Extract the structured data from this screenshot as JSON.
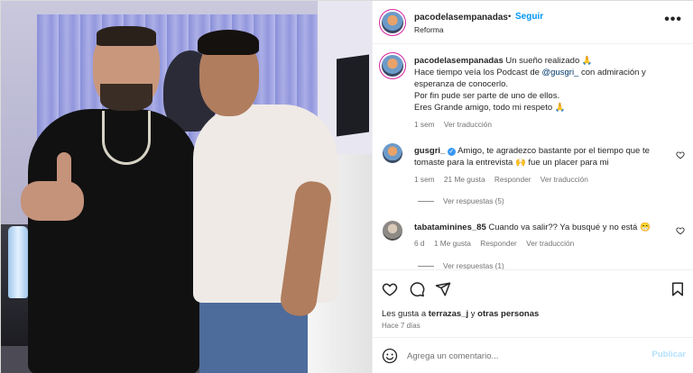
{
  "post": {
    "username": "pacodelasempanadas",
    "follow_label": "Seguir",
    "location": "Reforma",
    "more_label": "•••",
    "photo_alt": "Two men posing in a studio"
  },
  "caption": {
    "username": "pacodelasempanadas",
    "line1": "Un sueño realizado 🙏",
    "line2_pre": "Hace tiempo veía los Podcast de ",
    "mention": "@gusgri_",
    "line2_post": " con admiración y",
    "line3": "esperanza de conocerlo.",
    "line4": "Por fin pude ser parte de uno de ellos.",
    "line5": "Eres Grande amigo, todo mi respeto 🙏",
    "time": "1 sem",
    "translate": "Ver traducción"
  },
  "comments": [
    {
      "username": "gusgri_",
      "verified_mark": "✓",
      "text": "Amigo, te agradezco bastante por el tiempo que te tomaste para la entrevista 🙌 fue un placer para mi",
      "time": "1 sem",
      "likes": "21 Me gusta",
      "reply": "Responder",
      "translate": "Ver traducción",
      "replies": "Ver respuestas (5)"
    },
    {
      "username": "tabataminines_85",
      "text": "Cuando va salir?? Ya busqué y no está 😁",
      "time": "6 d",
      "likes": "1 Me gusta",
      "reply": "Responder",
      "translate": "Ver traducción",
      "replies": "Ver respuestas (1)"
    }
  ],
  "actions": {
    "likes_pre": "Les gusta a ",
    "likes_user": "terrazas_j",
    "likes_post": " y ",
    "likes_others": "otras personas",
    "ago": "Hace 7 días"
  },
  "composer": {
    "placeholder": "Agrega un comentario...",
    "publish": "Publicar"
  },
  "colors": {
    "accent": "#0095f6",
    "text": "#262626",
    "muted": "#737373",
    "publish_disabled": "#b2dffc"
  },
  "icons": [
    "heart-icon",
    "comment-icon",
    "share-icon",
    "bookmark-icon",
    "emoji-icon",
    "more-icon",
    "verified-icon"
  ]
}
